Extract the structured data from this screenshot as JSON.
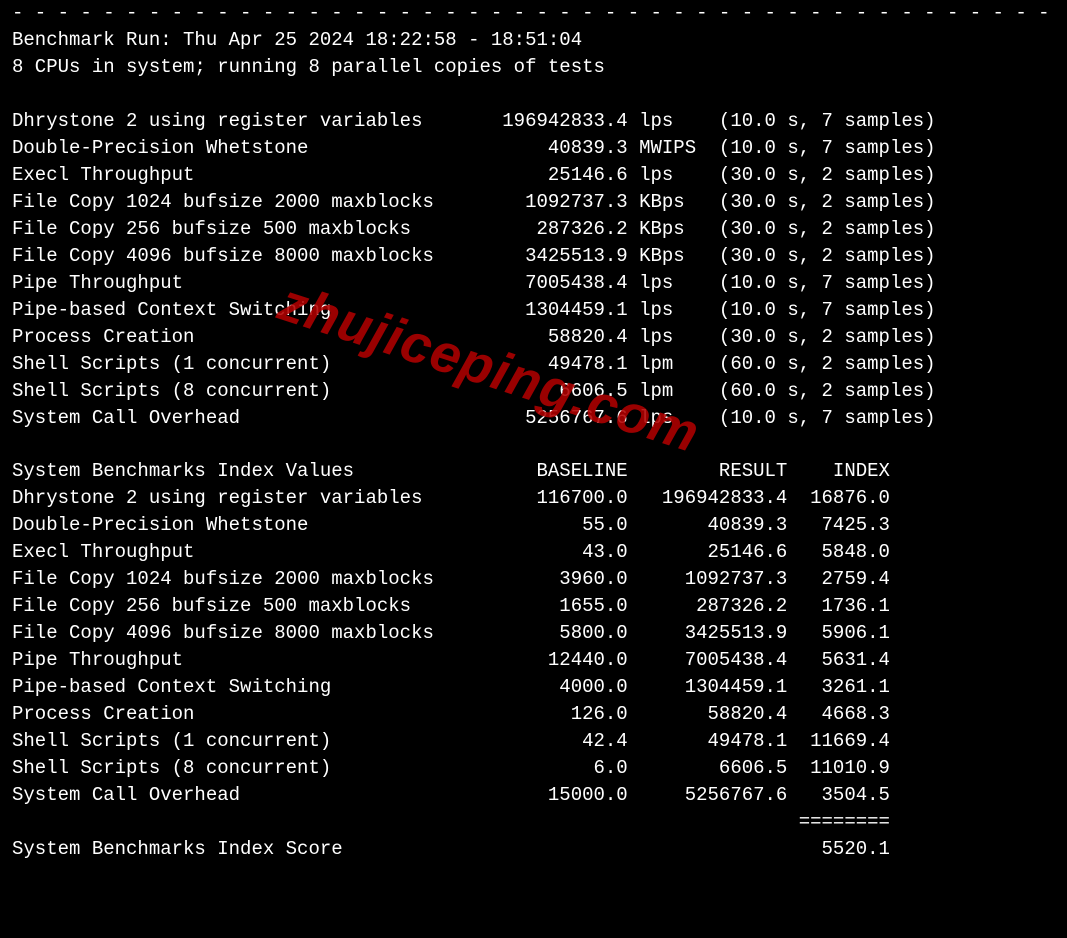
{
  "dashline": "- - - - - - - - - - - - - - - - - - - - - - - - - - - - - - - - - - - - - - - - - - - - - -",
  "run_info": "Benchmark Run: Thu Apr 25 2024 18:22:58 - 18:51:04",
  "cpu_info": "8 CPUs in system; running 8 parallel copies of tests",
  "raw_results": [
    {
      "name": "Dhrystone 2 using register variables",
      "value": "196942833.4",
      "unit": "lps",
      "timing": "(10.0 s, 7 samples)"
    },
    {
      "name": "Double-Precision Whetstone",
      "value": "40839.3",
      "unit": "MWIPS",
      "timing": "(10.0 s, 7 samples)"
    },
    {
      "name": "Execl Throughput",
      "value": "25146.6",
      "unit": "lps",
      "timing": "(30.0 s, 2 samples)"
    },
    {
      "name": "File Copy 1024 bufsize 2000 maxblocks",
      "value": "1092737.3",
      "unit": "KBps",
      "timing": "(30.0 s, 2 samples)"
    },
    {
      "name": "File Copy 256 bufsize 500 maxblocks",
      "value": "287326.2",
      "unit": "KBps",
      "timing": "(30.0 s, 2 samples)"
    },
    {
      "name": "File Copy 4096 bufsize 8000 maxblocks",
      "value": "3425513.9",
      "unit": "KBps",
      "timing": "(30.0 s, 2 samples)"
    },
    {
      "name": "Pipe Throughput",
      "value": "7005438.4",
      "unit": "lps",
      "timing": "(10.0 s, 7 samples)"
    },
    {
      "name": "Pipe-based Context Switching",
      "value": "1304459.1",
      "unit": "lps",
      "timing": "(10.0 s, 7 samples)"
    },
    {
      "name": "Process Creation",
      "value": "58820.4",
      "unit": "lps",
      "timing": "(30.0 s, 2 samples)"
    },
    {
      "name": "Shell Scripts (1 concurrent)",
      "value": "49478.1",
      "unit": "lpm",
      "timing": "(60.0 s, 2 samples)"
    },
    {
      "name": "Shell Scripts (8 concurrent)",
      "value": "6606.5",
      "unit": "lpm",
      "timing": "(60.0 s, 2 samples)"
    },
    {
      "name": "System Call Overhead",
      "value": "5256767.6",
      "unit": "lps",
      "timing": "(10.0 s, 7 samples)"
    }
  ],
  "index_header": {
    "title": "System Benchmarks Index Values",
    "baseline": "BASELINE",
    "result": "RESULT",
    "index": "INDEX"
  },
  "index_results": [
    {
      "name": "Dhrystone 2 using register variables",
      "baseline": "116700.0",
      "result": "196942833.4",
      "index": "16876.0"
    },
    {
      "name": "Double-Precision Whetstone",
      "baseline": "55.0",
      "result": "40839.3",
      "index": "7425.3"
    },
    {
      "name": "Execl Throughput",
      "baseline": "43.0",
      "result": "25146.6",
      "index": "5848.0"
    },
    {
      "name": "File Copy 1024 bufsize 2000 maxblocks",
      "baseline": "3960.0",
      "result": "1092737.3",
      "index": "2759.4"
    },
    {
      "name": "File Copy 256 bufsize 500 maxblocks",
      "baseline": "1655.0",
      "result": "287326.2",
      "index": "1736.1"
    },
    {
      "name": "File Copy 4096 bufsize 8000 maxblocks",
      "baseline": "5800.0",
      "result": "3425513.9",
      "index": "5906.1"
    },
    {
      "name": "Pipe Throughput",
      "baseline": "12440.0",
      "result": "7005438.4",
      "index": "5631.4"
    },
    {
      "name": "Pipe-based Context Switching",
      "baseline": "4000.0",
      "result": "1304459.1",
      "index": "3261.1"
    },
    {
      "name": "Process Creation",
      "baseline": "126.0",
      "result": "58820.4",
      "index": "4668.3"
    },
    {
      "name": "Shell Scripts (1 concurrent)",
      "baseline": "42.4",
      "result": "49478.1",
      "index": "11669.4"
    },
    {
      "name": "Shell Scripts (8 concurrent)",
      "baseline": "6.0",
      "result": "6606.5",
      "index": "11010.9"
    },
    {
      "name": "System Call Overhead",
      "baseline": "15000.0",
      "result": "5256767.6",
      "index": "3504.5"
    }
  ],
  "score_rule": "========",
  "score_label": "System Benchmarks Index Score",
  "score_value": "5520.1",
  "watermark": "zhujiceping.com"
}
